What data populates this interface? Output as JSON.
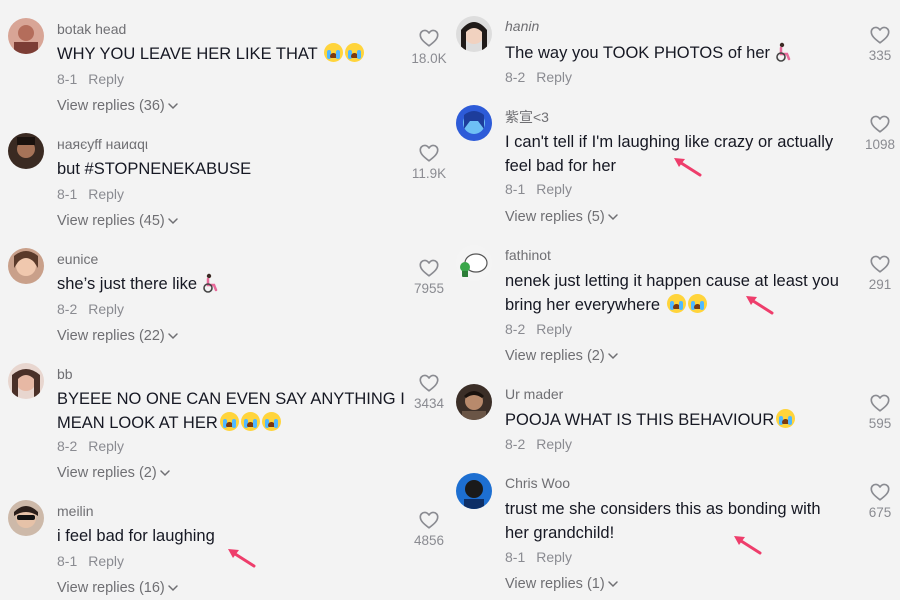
{
  "left": [
    {
      "username": "botak head",
      "text": "WHY YOU LEAVE HER LIKE THAT",
      "emoji": "cry x2",
      "date": "8-1",
      "reply": "Reply",
      "view_replies": "View replies (36)",
      "likes": "18.0K"
    },
    {
      "username": "наяєуff наиαqι",
      "text": "but #STOPNENEKABUSE",
      "date": "8-1",
      "reply": "Reply",
      "view_replies": "View replies (45)",
      "likes": "11.9K"
    },
    {
      "username": "eunice",
      "text": "she’s just there like",
      "emoji": "wheelchair",
      "date": "8-2",
      "reply": "Reply",
      "view_replies": "View replies (22)",
      "likes": "7955"
    },
    {
      "username": "bb",
      "text": "BYEEE NO ONE CAN EVEN SAY ANYTHING I",
      "text2": "MEAN LOOK AT HER",
      "emoji": "cry x3",
      "date": "8-2",
      "reply": "Reply",
      "view_replies": "View replies (2)",
      "likes": "3434"
    },
    {
      "username": "meilin",
      "text": "i feel bad for laughing",
      "date": "8-1",
      "reply": "Reply",
      "view_replies": "View replies (16)",
      "likes": "4856"
    }
  ],
  "right": [
    {
      "username": "hanin",
      "text": "The way you TOOK PHOTOS of her",
      "emoji": "wheelchair",
      "date": "8-2",
      "reply": "Reply",
      "likes": "335"
    },
    {
      "username": "紫宣<3",
      "text": "I can't tell if I'm laughing like crazy or actually",
      "text2": "feel bad for her",
      "date": "8-1",
      "reply": "Reply",
      "view_replies": "View replies (5)",
      "likes": "1098"
    },
    {
      "username": "fathinot",
      "text": "nenek just letting it happen cause at least you",
      "text2": "bring her everywhere",
      "emoji": "cry x2",
      "date": "8-2",
      "reply": "Reply",
      "view_replies": "View replies (2)",
      "likes": "291"
    },
    {
      "username": "Ur mader",
      "text": "POOJA WHAT IS THIS BEHAVIOUR",
      "emoji": "cry x1",
      "date": "8-2",
      "reply": "Reply",
      "likes": "595"
    },
    {
      "username": "Chris Woo",
      "text": "trust me she considers this as bonding with",
      "text2": "her grandchild!",
      "date": "8-1",
      "reply": "Reply",
      "view_replies": "View replies (1)",
      "likes": "675"
    }
  ],
  "colors": {
    "accent_arrow": "#ee3d6b",
    "text": "#161823",
    "muted": "#8a8b91"
  }
}
